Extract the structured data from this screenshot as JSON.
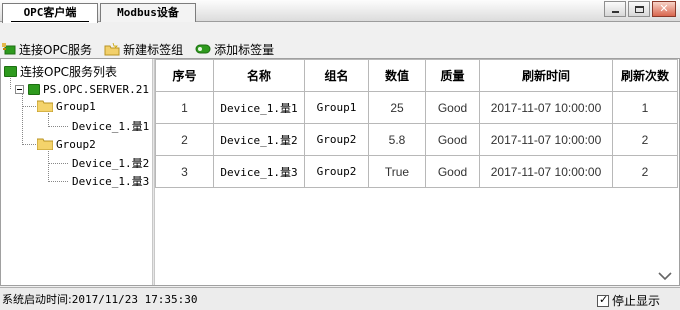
{
  "tabs": [
    {
      "label": "OPC客户端",
      "active": true
    },
    {
      "label": "Modbus设备",
      "active": false
    }
  ],
  "window_buttons": {
    "minimize_icon": "minimize-icon",
    "maximize_icon": "maximize-icon",
    "close_icon": "close-icon"
  },
  "toolbar": {
    "connect_label": "连接OPC服务",
    "new_group_label": "新建标签组",
    "add_tag_label": "添加标签量"
  },
  "tree": {
    "root": "连接OPC服务列表",
    "server": "PS.OPC.SERVER.21",
    "groups": [
      {
        "name": "Group1",
        "items": [
          "Device_1.量1"
        ]
      },
      {
        "name": "Group2",
        "items": [
          "Device_1.量2",
          "Device_1.量3"
        ]
      }
    ]
  },
  "table": {
    "columns": [
      "序号",
      "名称",
      "组名",
      "数值",
      "质量",
      "刷新时间",
      "刷新次数"
    ],
    "rows": [
      [
        "1",
        "Device_1.量1",
        "Group1",
        "25",
        "Good",
        "2017-11-07 10:00:00",
        "1"
      ],
      [
        "2",
        "Device_1.量2",
        "Group2",
        "5.8",
        "Good",
        "2017-11-07 10:00:00",
        "2"
      ],
      [
        "3",
        "Device_1.量3",
        "Group2",
        "True",
        "Good",
        "2017-11-07 10:00:00",
        "2"
      ]
    ]
  },
  "status": {
    "start_time_label": "系统启动时间:",
    "start_time_value": "2017/11/23 17:35:30",
    "stop_display_label": "停止显示",
    "stop_display_checked": true
  }
}
